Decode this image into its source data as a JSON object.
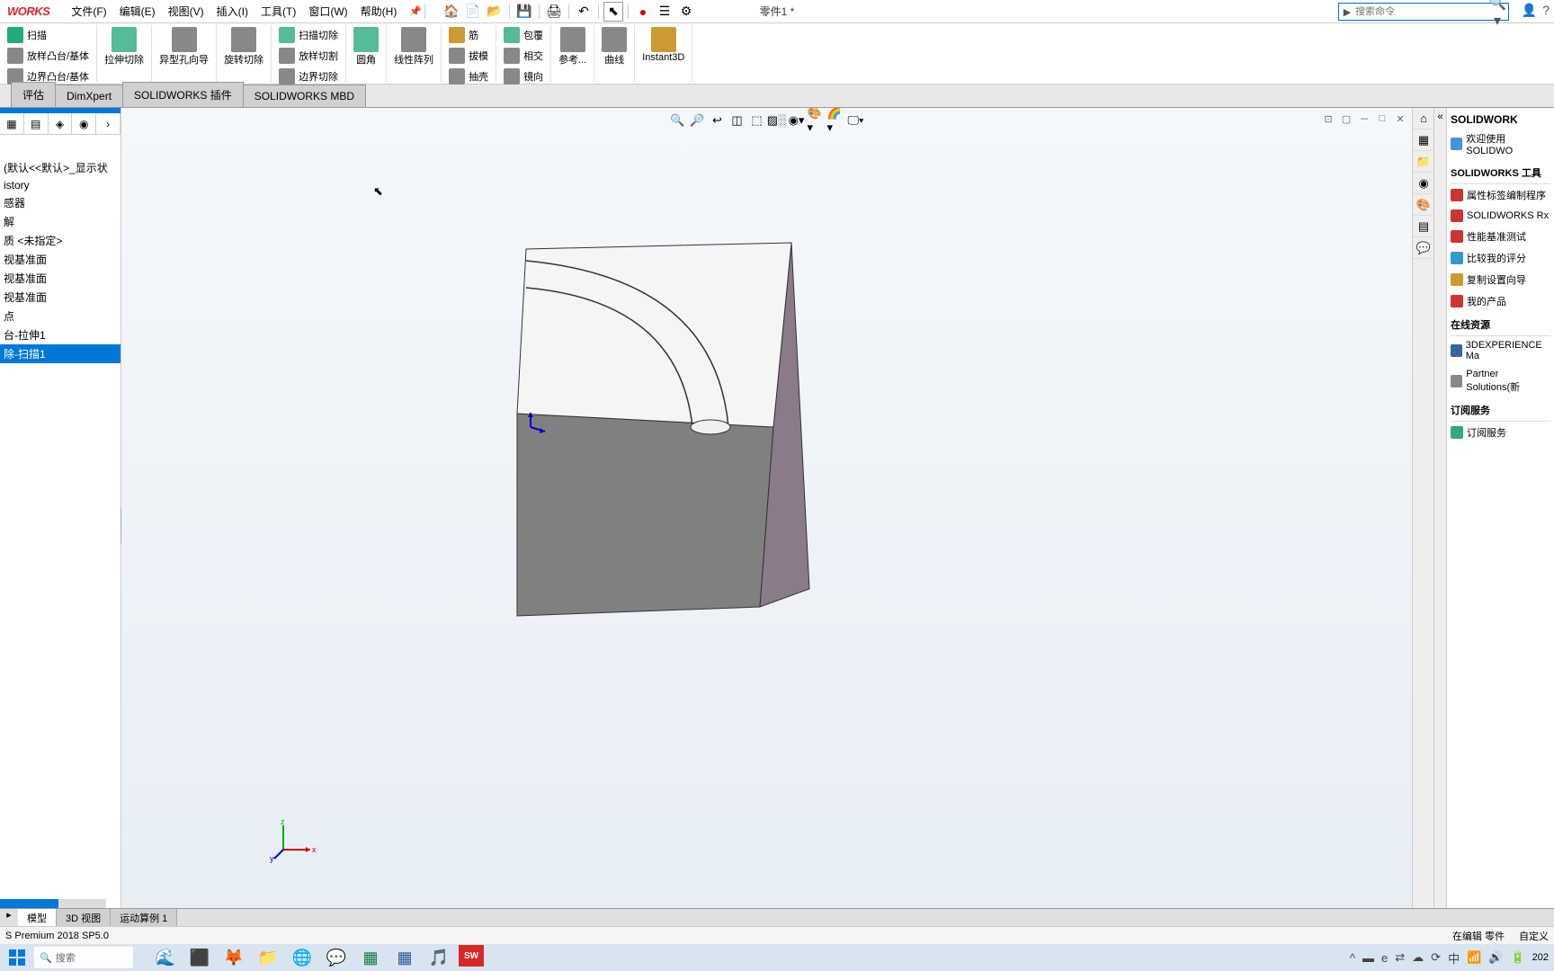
{
  "app": {
    "logo": "WORKS",
    "doc_title": "零件1 *"
  },
  "menu": {
    "file": "文件(F)",
    "edit": "编辑(E)",
    "view": "视图(V)",
    "insert": "插入(I)",
    "tools": "工具(T)",
    "window": "窗口(W)",
    "help": "帮助(H)"
  },
  "search": {
    "placeholder": "搜索命令"
  },
  "ribbon": {
    "sweep": "扫描",
    "loft": "放样凸台/基体",
    "boundary": "边界凸台/基体",
    "extrude_cut": "拉伸切除",
    "hole_wizard": "异型孔向导",
    "revolve_cut": "旋转切除",
    "sweep_cut": "扫描切除",
    "loft_cut": "放样切割",
    "boundary_cut": "边界切除",
    "fillet": "圆角",
    "linear_pattern": "线性阵列",
    "rib": "筋",
    "draft": "拔模",
    "shell": "抽壳",
    "wrap": "包覆",
    "intersect": "相交",
    "mirror": "镜向",
    "reference": "参考...",
    "curves": "曲线",
    "instant3d": "Instant3D"
  },
  "tabs": {
    "evaluate": "评估",
    "dimxpert": "DimXpert",
    "sw_addins": "SOLIDWORKS 插件",
    "sw_mbd": "SOLIDWORKS MBD"
  },
  "tree": {
    "config": "(默认<<默认>_显示状",
    "history": "istory",
    "sensors": "感器",
    "annotations": "解",
    "material": "质 <未指定>",
    "front_plane": "视基准面",
    "top_plane": "视基准面",
    "right_plane": "视基准面",
    "origin": "点",
    "boss_extrude": "台-拉伸1",
    "cut_sweep": "除-扫描1"
  },
  "task_panel": {
    "welcome": "欢迎使用  SOLIDWO",
    "tools_header": "SOLIDWORKS 工具",
    "property_tab": "属性标签编制程序",
    "sw_rx": "SOLIDWORKS Rx",
    "perf_benchmark": "性能基准测试",
    "compare_score": "比较我的评分",
    "copy_settings": "复制设置向导",
    "my_products": "我的产品",
    "online_header": "在线资源",
    "exp_market": "3DEXPERIENCE Ma",
    "partner": "Partner Solutions(新",
    "subscribe_header": "订阅服务",
    "subscribe": "订阅服务",
    "brand": "SOLIDWORK"
  },
  "bottom_tabs": {
    "model": "模型",
    "view3d": "3D 视图",
    "motion": "运动算例 1"
  },
  "status": {
    "left": "S Premium 2018 SP5.0",
    "editing": "在编辑 零件",
    "custom": "自定义"
  },
  "taskbar": {
    "search": "搜索",
    "time": "202"
  }
}
